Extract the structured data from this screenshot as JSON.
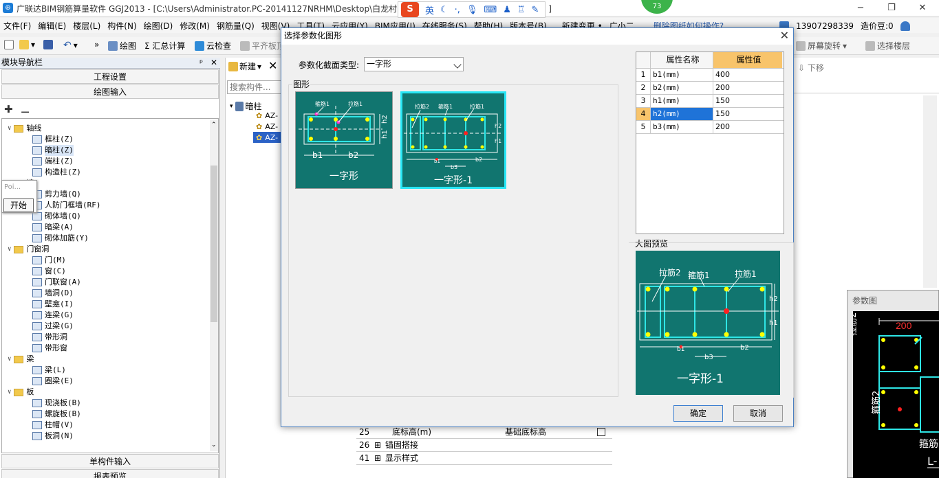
{
  "app": {
    "title": "广联达BIM钢筋算量软件 GGJ2013 - [C:\\Users\\Administrator.PC-20141127NRHM\\Desktop\\白龙村",
    "title_tail": "]",
    "minimize": "−",
    "restore": "❐",
    "close": "✕",
    "notif_count": "73"
  },
  "ime": {
    "logo": "S",
    "mode": "英"
  },
  "menu": [
    "文件(F)",
    "编辑(E)",
    "楼层(L)",
    "构件(N)",
    "绘图(D)",
    "修改(M)",
    "钢筋量(Q)",
    "视图(V)",
    "工具(T)",
    "云应用(Y)",
    "BIM应用(I)",
    "在线服务(S)",
    "帮助(H)",
    "版本号(B)",
    "新建变更 •",
    "广小二",
    "删除图纸如何操作?"
  ],
  "account": {
    "phone": "13907298339",
    "coin_label": "造价豆:0"
  },
  "toolbar": {
    "draw": "绘图",
    "sum": "Σ 汇总计算",
    "cloud_check": "云检查",
    "align": "平齐板顶",
    "screen_rotate": "屏幕旋转",
    "select_floor": "选择楼层",
    "more": "»",
    "new": "新建",
    "move_down": "下移",
    "search_placeholder": "搜索构件..."
  },
  "nav": {
    "title": "模块导航栏",
    "pin": "ᵖ",
    "close": "✕",
    "tab_project": "工程设置",
    "tab_draw": "绘图输入",
    "tab_single": "单构件输入",
    "tab_report": "报表预览",
    "tree": [
      {
        "level": 0,
        "label": "轴线",
        "type": "folder"
      },
      {
        "level": 1,
        "label": "框柱(Z)",
        "type": "item"
      },
      {
        "level": 1,
        "label": "暗柱(Z)",
        "type": "item",
        "selected": true
      },
      {
        "level": 1,
        "label": "端柱(Z)",
        "type": "item"
      },
      {
        "level": 1,
        "label": "构造柱(Z)",
        "type": "item"
      },
      {
        "level": 0,
        "label": "墙",
        "type": "folder"
      },
      {
        "level": 1,
        "label": "剪力墙(Q)",
        "type": "item"
      },
      {
        "level": 1,
        "label": "人防门框墙(RF)",
        "type": "item"
      },
      {
        "level": 1,
        "label": "砌体墙(Q)",
        "type": "item"
      },
      {
        "level": 1,
        "label": "暗梁(A)",
        "type": "item"
      },
      {
        "level": 1,
        "label": "砌体加筋(Y)",
        "type": "item"
      },
      {
        "level": 0,
        "label": "门窗洞",
        "type": "folder"
      },
      {
        "level": 1,
        "label": "门(M)",
        "type": "item"
      },
      {
        "level": 1,
        "label": "窗(C)",
        "type": "item"
      },
      {
        "level": 1,
        "label": "门联窗(A)",
        "type": "item"
      },
      {
        "level": 1,
        "label": "墙洞(D)",
        "type": "item"
      },
      {
        "level": 1,
        "label": "壁龛(I)",
        "type": "item"
      },
      {
        "level": 1,
        "label": "连梁(G)",
        "type": "item"
      },
      {
        "level": 1,
        "label": "过梁(G)",
        "type": "item"
      },
      {
        "level": 1,
        "label": "带形洞",
        "type": "item"
      },
      {
        "level": 1,
        "label": "带形窗",
        "type": "item"
      },
      {
        "level": 0,
        "label": "梁",
        "type": "folder"
      },
      {
        "level": 1,
        "label": "梁(L)",
        "type": "item"
      },
      {
        "level": 1,
        "label": "圈梁(E)",
        "type": "item"
      },
      {
        "level": 0,
        "label": "板",
        "type": "folder"
      },
      {
        "level": 1,
        "label": "现浇板(B)",
        "type": "item"
      },
      {
        "level": 1,
        "label": "螺旋板(B)",
        "type": "item"
      },
      {
        "level": 1,
        "label": "柱帽(V)",
        "type": "item"
      },
      {
        "level": 1,
        "label": "板洞(N)",
        "type": "item"
      }
    ],
    "popup_placeholder": "Poi...",
    "popup_start": "开始"
  },
  "component_tree": {
    "root": "暗柱",
    "items": [
      "AZ-",
      "AZ-",
      "AZ-"
    ]
  },
  "dialog": {
    "title": "选择参数化图形",
    "close": "✕",
    "type_label": "参数化截面类型:",
    "type_value": "一字形",
    "group_label": "图形",
    "shapes": [
      {
        "name": "一字形",
        "selected": false
      },
      {
        "name": "一字形-1",
        "selected": true
      }
    ],
    "thumb1_labels": [
      "箍筋1",
      "拉筋1",
      "b1",
      "b2",
      "h1",
      "h2"
    ],
    "thumb2_labels": [
      "拉筋2",
      "箍筋1",
      "拉筋1",
      "h2",
      "h1",
      "b1",
      "b3",
      "b2"
    ],
    "props_header": [
      "属性名称",
      "属性值"
    ],
    "props": [
      {
        "idx": "1",
        "name": "b1(mm)",
        "value": "400"
      },
      {
        "idx": "2",
        "name": "b2(mm)",
        "value": "200"
      },
      {
        "idx": "3",
        "name": "h1(mm)",
        "value": "150"
      },
      {
        "idx": "4",
        "name": "h2(mm)",
        "value": "150",
        "selected": true
      },
      {
        "idx": "5",
        "name": "b3(mm)",
        "value": "200"
      }
    ],
    "preview_label": "大图预览",
    "preview_caption": "一字形-1",
    "preview_labels": [
      "拉筋2",
      "箍筋1",
      "拉筋1",
      "h2",
      "h1",
      "b1",
      "b3",
      "b2"
    ],
    "ok": "确定",
    "cancel": "取消"
  },
  "bottom_table": [
    {
      "num": "25",
      "name": "底标高(m)",
      "value": "基础底标高"
    },
    {
      "num": "26",
      "name": "锚固搭接",
      "value": ""
    },
    {
      "num": "41",
      "name": "显示样式",
      "value": ""
    }
  ],
  "param_window": {
    "title": "参数图",
    "dim": "200",
    "label_a": "拉筋2",
    "label_b": "箍筋2",
    "label_c": "箍筋",
    "label_d": "L-"
  },
  "colors": {
    "dialog_border": "#4a7fc0",
    "teal": "#11756f",
    "cyan": "#27e6f5",
    "header_orange": "#f8c46b",
    "select_blue": "#1f73d8"
  }
}
